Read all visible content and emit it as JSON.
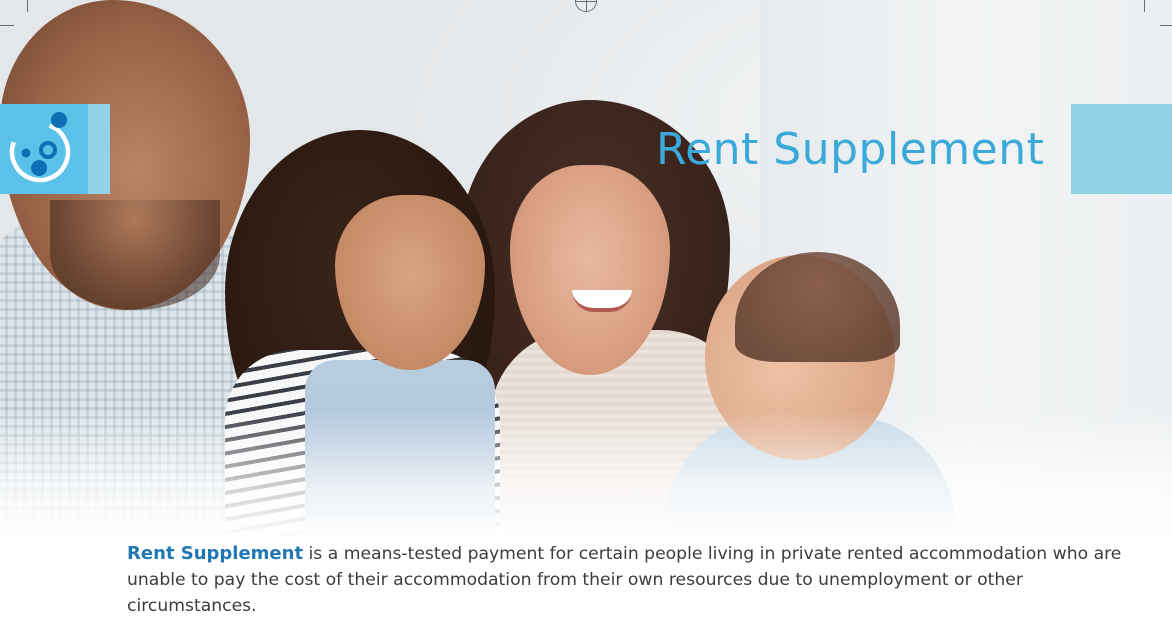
{
  "title": "Rent Supplement",
  "intro": {
    "lead": "Rent Supplement",
    "text": " is a means-tested payment for certain people living in private rented accommodation who are unable to pay the cost of their accommodation from their own resources due to unemployment or other circumstances."
  },
  "colors": {
    "title": "#3ba9d9",
    "lead": "#1f78b4",
    "tile_light": "#93d3e8",
    "tile_dark": "#5cc1e8"
  },
  "icons": {
    "logo": "circle-dots-logo-icon"
  }
}
